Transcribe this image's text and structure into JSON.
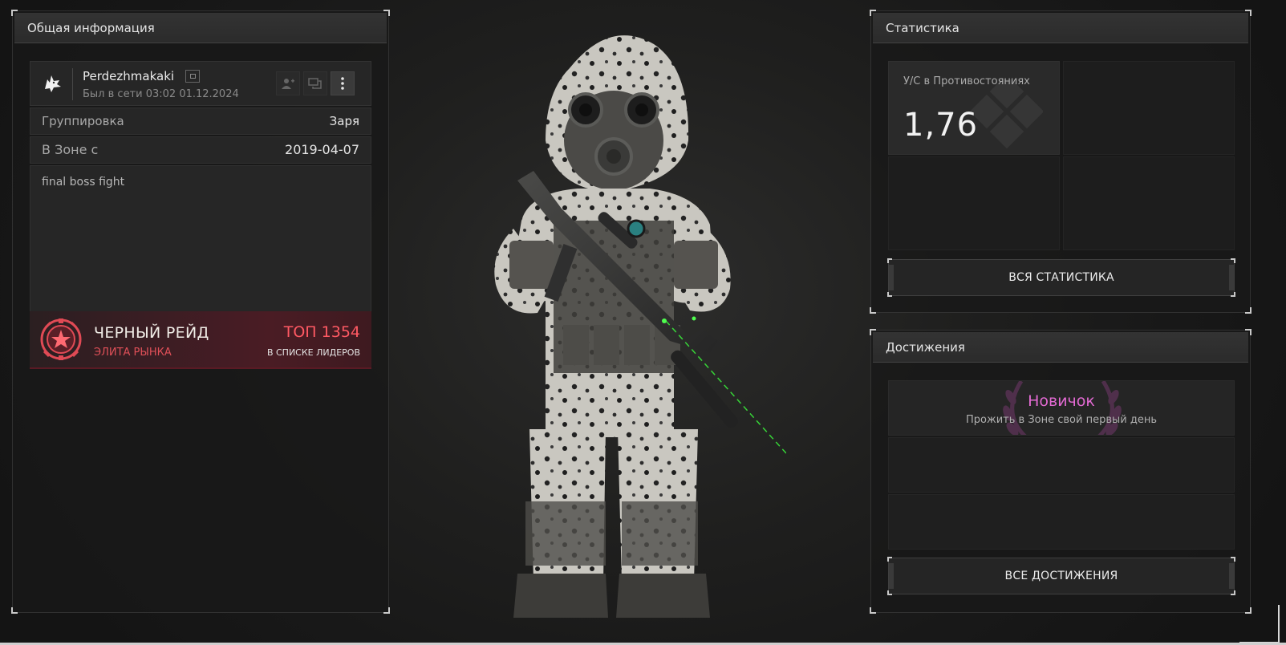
{
  "general": {
    "title": "Общая информация",
    "username": "Perdezhmakaki",
    "last_seen": "Был в сети 03:02 01.12.2024",
    "faction_label": "Группировка",
    "faction_value": "Заря",
    "zone_label": "В Зоне с",
    "zone_value": "2019-04-07",
    "bio": "final boss fight",
    "icons": {
      "faction_logo": "wolf-head-icon",
      "copy": "copy-icon",
      "add_friend": "add-friend-icon",
      "message": "message-icon",
      "menu": "more-vertical-icon"
    }
  },
  "raid": {
    "title": "ЧЕРНЫЙ РЕЙД",
    "subtitle": "ЭЛИТА РЫНКА",
    "rank": "ТОП 1354",
    "rank_sub": "В СПИСКЕ ЛИДЕРОВ",
    "emblem": "black-raid-emblem-icon"
  },
  "stats": {
    "title": "Статистика",
    "kd_label": "У/С в Противостояниях",
    "kd_value": "1,76",
    "button": "ВСЯ СТАТИСТИКА"
  },
  "achievements": {
    "title": "Достижения",
    "items": [
      {
        "title": "Новичок",
        "description": "Прожить в Зоне свой первый день"
      }
    ],
    "button": "ВСЕ ДОСТИЖЕНИЯ"
  },
  "colors": {
    "accent_red": "#ff5963",
    "achievement_pink": "#e26ad2",
    "laser_green": "#39e83a",
    "background": "#1d1d1d"
  }
}
